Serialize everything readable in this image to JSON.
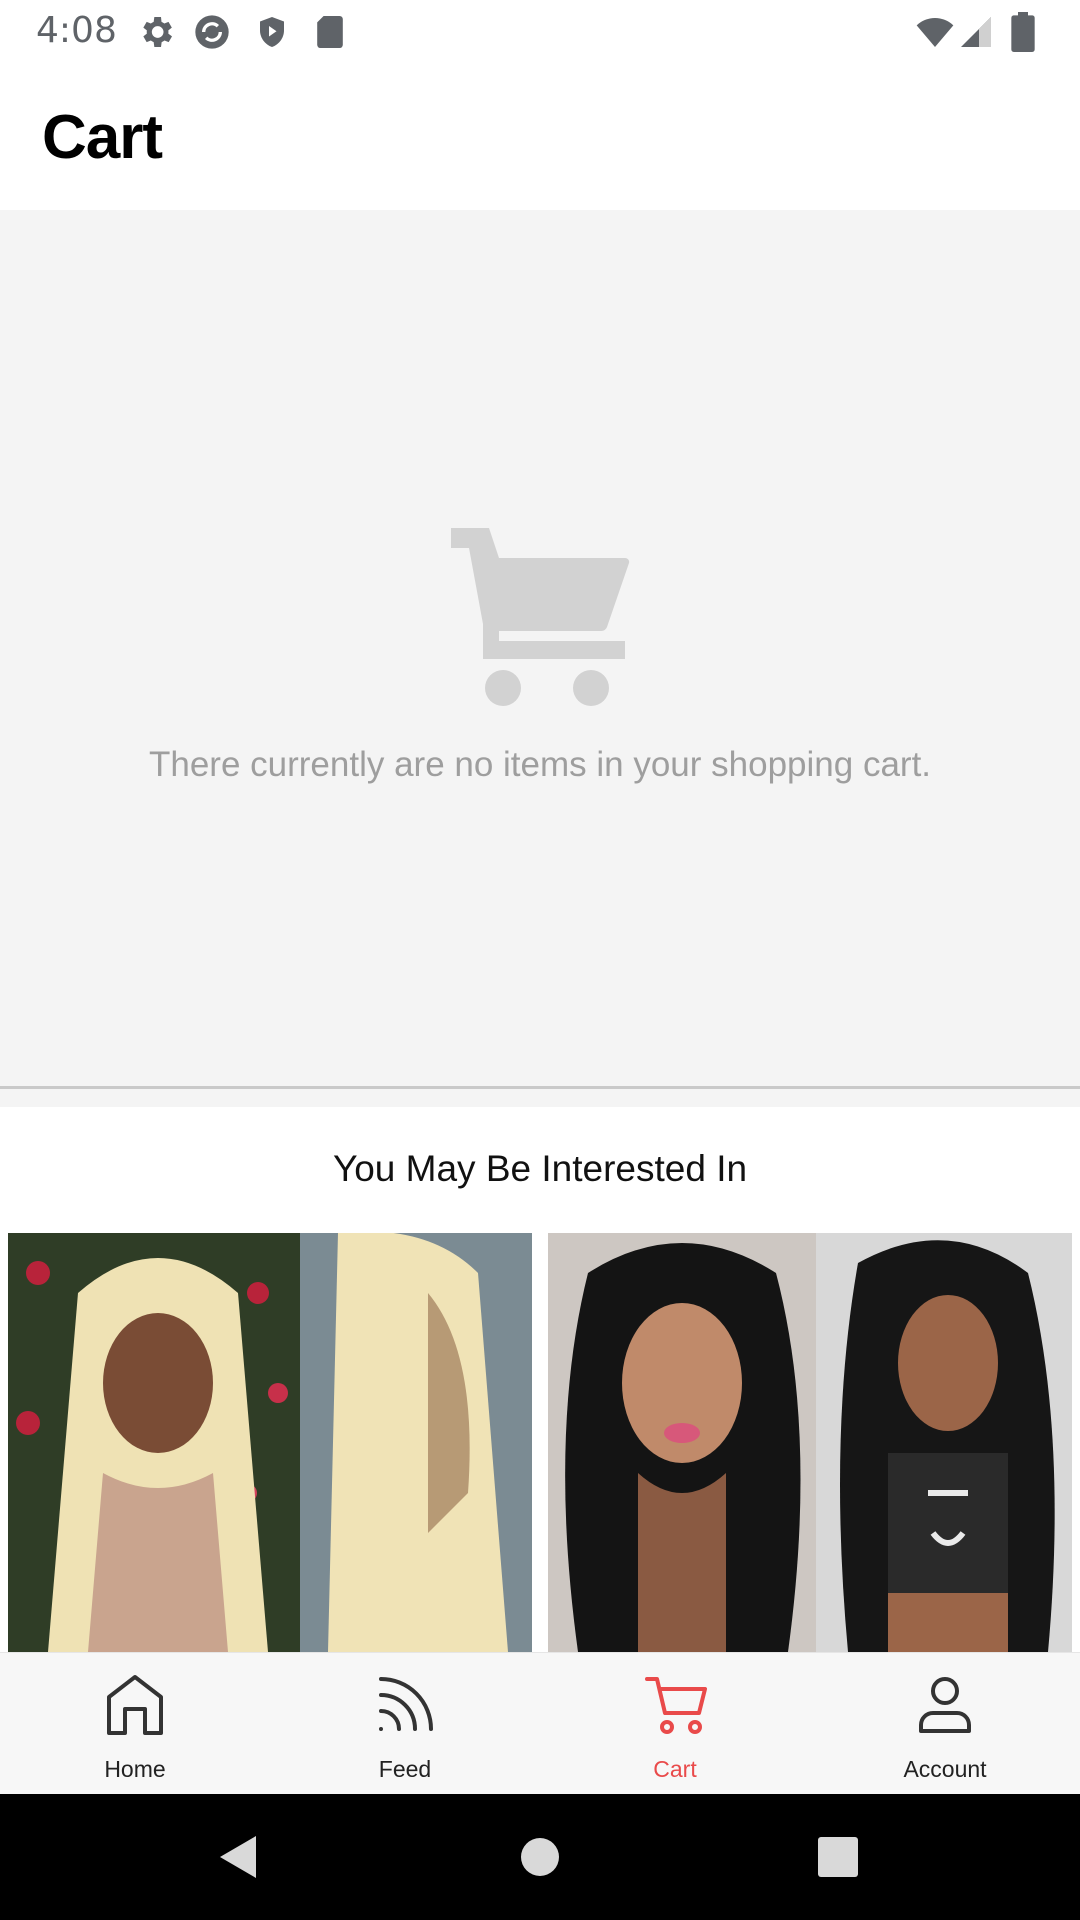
{
  "status_bar": {
    "time": "4:08",
    "left_icons": [
      "settings-icon",
      "sync-icon",
      "shield-play-icon",
      "sd-card-icon"
    ],
    "right_icons": [
      "wifi-icon",
      "signal-icon",
      "battery-icon"
    ]
  },
  "header": {
    "title": "Cart"
  },
  "empty_state": {
    "icon": "shopping-cart-icon",
    "message": "There currently are no items in your shopping cart."
  },
  "recommendations": {
    "title": "You May Be Interested In",
    "products": [
      {
        "image": "blonde-straight-wig-product-image"
      },
      {
        "image": "black-body-wave-wig-product-image"
      }
    ]
  },
  "bottom_nav": {
    "items": [
      {
        "label": "Home",
        "icon": "home-icon",
        "active": false
      },
      {
        "label": "Feed",
        "icon": "feed-icon",
        "active": false
      },
      {
        "label": "Cart",
        "icon": "cart-icon",
        "active": true
      },
      {
        "label": "Account",
        "icon": "account-icon",
        "active": false
      }
    ],
    "active_color": "#e94a4a"
  },
  "system_nav": {
    "buttons": [
      "back-button",
      "home-button",
      "recents-button"
    ]
  },
  "colors": {
    "background_gray": "#f4f4f4",
    "accent": "#e94a4a",
    "muted_text": "#9e9e9e"
  }
}
